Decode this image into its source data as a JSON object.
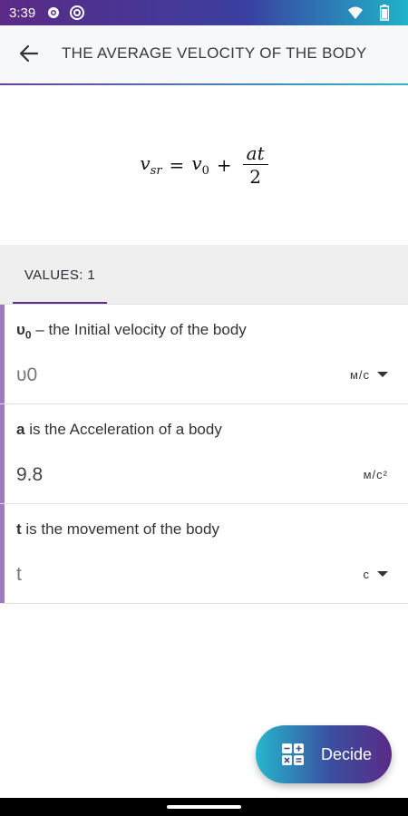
{
  "status_bar": {
    "time": "3:39",
    "icons": [
      "settings-icon",
      "at-sign-icon",
      "wifi-icon",
      "battery-icon"
    ]
  },
  "app_bar": {
    "title": "THE AVERAGE VELOCITY OF THE BODY"
  },
  "formula": {
    "lhs": "v",
    "lhs_sub": "sr",
    "equals": "=",
    "v0": "v",
    "v0_sub": "0",
    "plus": "+",
    "numerator": "at",
    "denominator": "2"
  },
  "tabs": [
    {
      "label": "VALUES: 1",
      "selected": true
    }
  ],
  "fields": [
    {
      "symbol": "υ",
      "symbol_sub": "0",
      "label_rest": " – the Initial velocity of the body",
      "value": "",
      "placeholder": "υ0",
      "unit": "м/с",
      "has_dropdown": true
    },
    {
      "symbol": "a",
      "symbol_sub": "",
      "label_rest": " is the Acceleration of a body",
      "value": "9.8",
      "placeholder": "",
      "unit": "м/с²",
      "has_dropdown": false
    },
    {
      "symbol": "t",
      "symbol_sub": "",
      "label_rest": " is the movement of the body",
      "value": "",
      "placeholder": "t",
      "unit": "с",
      "has_dropdown": true
    }
  ],
  "fab": {
    "label": "Decide",
    "icon": "calculator-icon"
  },
  "colors": {
    "accent_purple": "#5a2e8a",
    "accent_teal": "#26b7cc",
    "field_accent": "#9c7bbd"
  }
}
